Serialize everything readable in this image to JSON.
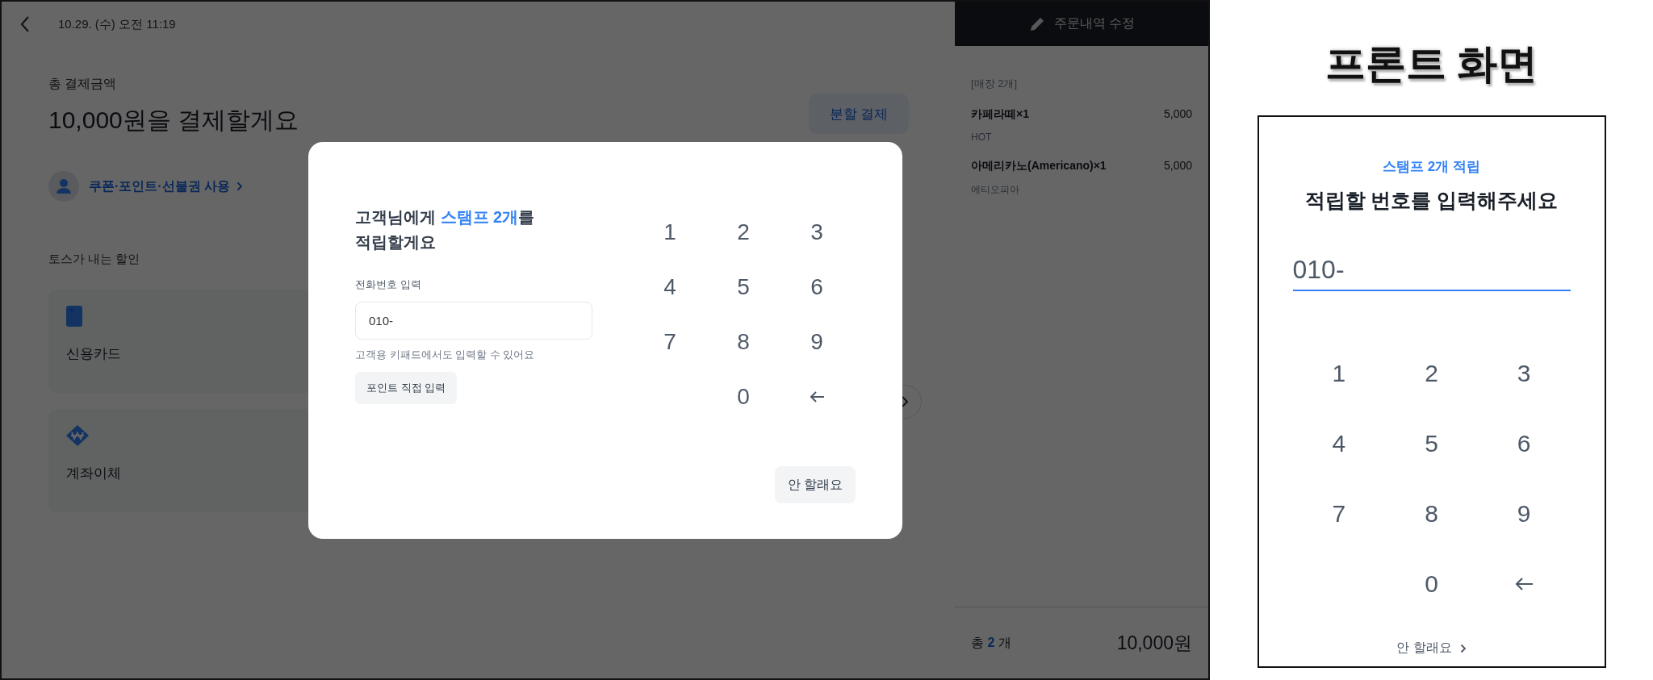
{
  "pos": {
    "header": {
      "datetime": "10.29. (수) 오전 11:19"
    },
    "total_label": "총 결제금액",
    "heading": "10,000원을 결제할게요",
    "split_button": "분할 결제",
    "coupon_link": "쿠폰·포인트·선불권 사용",
    "discount_label": "토스가 내는 할인",
    "methods": [
      {
        "kind": "card",
        "label": "신용카드"
      },
      {
        "kind": "transfer",
        "label": "계좌이체"
      }
    ]
  },
  "order_panel": {
    "edit_button": "주문내역 수정",
    "group_label": "[매장 2개]",
    "items": [
      {
        "name": "카페라떼×1",
        "price": "5,000",
        "option": "HOT"
      },
      {
        "name": "아메리카노(Americano)×1",
        "price": "5,000",
        "option": "에티오피아"
      }
    ],
    "total_prefix": "총",
    "total_count": "2",
    "total_suffix": "개",
    "total_amount": "10,000원"
  },
  "modal": {
    "title": [
      {
        "text": "고객님에게 ",
        "highlight": false
      },
      {
        "text": "스탬프 2개",
        "highlight": true
      },
      {
        "text": "를\n적립할게요",
        "highlight": false
      }
    ],
    "field_label": "전화번호 입력",
    "field_value": "010-",
    "hint": "고객용 키패드에서도 입력할 수 있어요",
    "points_button": "포인트 직접 입력",
    "keys": [
      {
        "kind": "digit",
        "label": "1"
      },
      {
        "kind": "digit",
        "label": "2"
      },
      {
        "kind": "digit",
        "label": "3"
      },
      {
        "kind": "digit",
        "label": "4"
      },
      {
        "kind": "digit",
        "label": "5"
      },
      {
        "kind": "digit",
        "label": "6"
      },
      {
        "kind": "digit",
        "label": "7"
      },
      {
        "kind": "digit",
        "label": "8"
      },
      {
        "kind": "digit",
        "label": "9"
      },
      {
        "kind": "blank"
      },
      {
        "kind": "digit",
        "label": "0"
      },
      {
        "kind": "backspace"
      }
    ],
    "cancel_button": "안 할래요"
  },
  "front": {
    "caption": "프론트 화면",
    "subtitle": "스탬프 2개 적립",
    "heading": "적립할 번호를 입력해주세요",
    "field_value": "010-",
    "keys": [
      {
        "kind": "digit",
        "label": "1"
      },
      {
        "kind": "digit",
        "label": "2"
      },
      {
        "kind": "digit",
        "label": "3"
      },
      {
        "kind": "digit",
        "label": "4"
      },
      {
        "kind": "digit",
        "label": "5"
      },
      {
        "kind": "digit",
        "label": "6"
      },
      {
        "kind": "digit",
        "label": "7"
      },
      {
        "kind": "digit",
        "label": "8"
      },
      {
        "kind": "digit",
        "label": "9"
      },
      {
        "kind": "blank"
      },
      {
        "kind": "digit",
        "label": "0"
      },
      {
        "kind": "backspace"
      }
    ],
    "cancel_link": "안 할래요"
  }
}
